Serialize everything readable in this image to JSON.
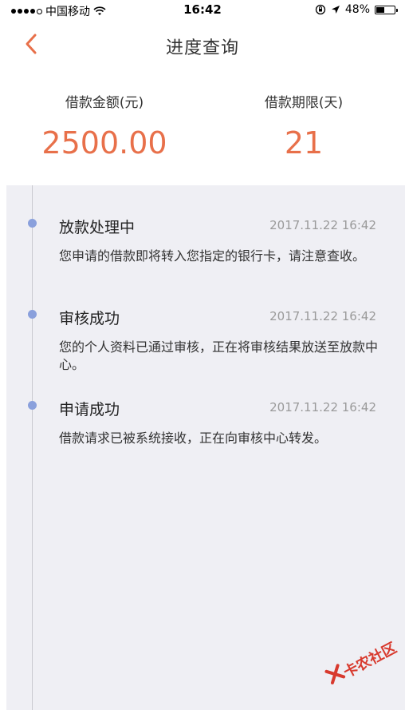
{
  "status_bar": {
    "carrier": "中国移动",
    "time": "16:42",
    "battery_text": "48%",
    "battery_level": 0.48
  },
  "nav": {
    "title": "进度查询",
    "back_icon": "chevron-left-icon"
  },
  "summary": {
    "amount_label": "借款金额(元)",
    "amount_value": "2500.00",
    "term_label": "借款期限(天)",
    "term_value": "21"
  },
  "timeline": {
    "items": [
      {
        "title": "放款处理中",
        "time": "2017.11.22 16:42",
        "desc": "您申请的借款即将转入您指定的银行卡，请注意查收。"
      },
      {
        "title": "审核成功",
        "time": "2017.11.22 16:42",
        "desc": "您的个人资料已通过审核，正在将审核结果放送至放款中心。"
      },
      {
        "title": "申请成功",
        "time": "2017.11.22 16:42",
        "desc": "借款请求已被系统接收，正在向审核中心转发。"
      }
    ]
  },
  "watermark": {
    "text": "卡农社区"
  },
  "colors": {
    "accent": "#e8704a",
    "dot": "#8aa0dc",
    "timeline_bg": "#efeff4"
  }
}
